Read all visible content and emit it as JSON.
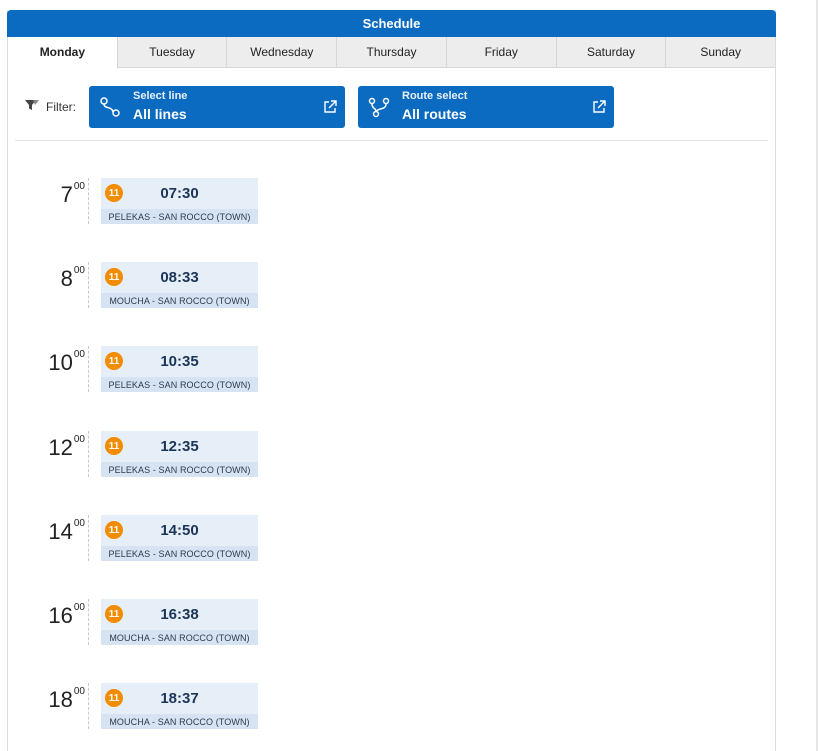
{
  "header": {
    "title": "Schedule"
  },
  "tabs": [
    {
      "label": "Monday",
      "active": true
    },
    {
      "label": "Tuesday",
      "active": false
    },
    {
      "label": "Wednesday",
      "active": false
    },
    {
      "label": "Thursday",
      "active": false
    },
    {
      "label": "Friday",
      "active": false
    },
    {
      "label": "Saturday",
      "active": false
    },
    {
      "label": "Sunday",
      "active": false
    }
  ],
  "filter": {
    "label": "Filter:",
    "line": {
      "small": "Select line",
      "value": "All lines"
    },
    "route": {
      "small": "Route select",
      "value": "All routes"
    }
  },
  "colors": {
    "primary": "#0b6bc0",
    "badge": "#f28c00",
    "card": "#e6eef8"
  },
  "departures": [
    {
      "hour": "7",
      "minutes": "00",
      "line": "11",
      "time": "07:30",
      "route": "PELEKAS - SAN ROCCO (TOWN)"
    },
    {
      "hour": "8",
      "minutes": "00",
      "line": "11",
      "time": "08:33",
      "route": "MOUCHA - SAN ROCCO (TOWN)"
    },
    {
      "hour": "10",
      "minutes": "00",
      "line": "11",
      "time": "10:35",
      "route": "PELEKAS - SAN ROCCO (TOWN)"
    },
    {
      "hour": "12",
      "minutes": "00",
      "line": "11",
      "time": "12:35",
      "route": "PELEKAS - SAN ROCCO (TOWN)"
    },
    {
      "hour": "14",
      "minutes": "00",
      "line": "11",
      "time": "14:50",
      "route": "PELEKAS - SAN ROCCO (TOWN)"
    },
    {
      "hour": "16",
      "minutes": "00",
      "line": "11",
      "time": "16:38",
      "route": "MOUCHA - SAN ROCCO (TOWN)"
    },
    {
      "hour": "18",
      "minutes": "00",
      "line": "11",
      "time": "18:37",
      "route": "MOUCHA - SAN ROCCO (TOWN)"
    }
  ]
}
